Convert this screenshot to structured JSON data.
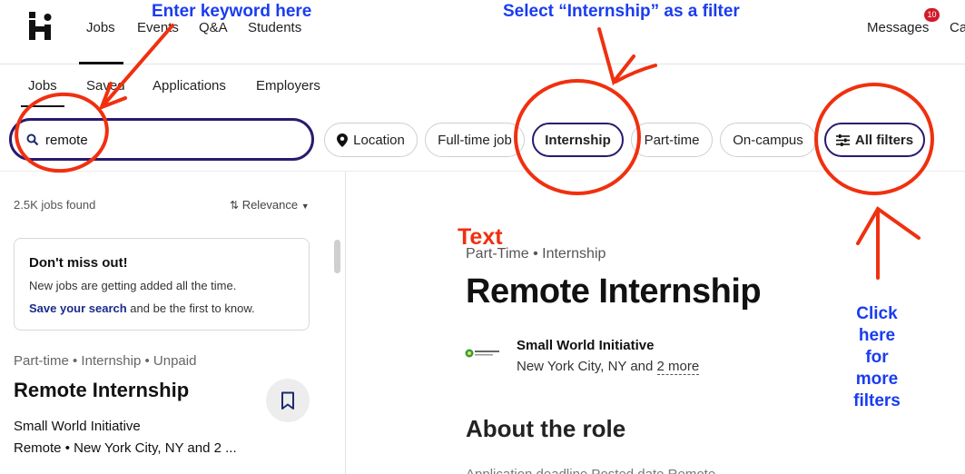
{
  "topnav": {
    "items": [
      {
        "label": "Jobs"
      },
      {
        "label": "Events"
      },
      {
        "label": "Q&A"
      },
      {
        "label": "Students"
      }
    ],
    "messages_label": "Messages",
    "messages_badge": "10",
    "cut_label": "Ca"
  },
  "subnav": {
    "items": [
      {
        "label": "Jobs"
      },
      {
        "label": "Saved"
      },
      {
        "label": "Applications"
      },
      {
        "label": "Employers"
      }
    ]
  },
  "filters": {
    "search_value": "remote",
    "location": "Location",
    "fulltime": "Full-time job",
    "internship": "Internship",
    "parttime": "Part-time",
    "oncampus": "On-campus",
    "allfilters": "All filters"
  },
  "results": {
    "count": "2.5K jobs found",
    "sort": "Relevance"
  },
  "alert": {
    "title": "Don't miss out!",
    "body": "New jobs are getting added all the time.",
    "link": "Save your search",
    "link_suffix": " and be the first to know."
  },
  "job_card": {
    "meta": "Part-time • Internship • Unpaid",
    "title": "Remote Internship",
    "employer": "Small World Initiative",
    "location": "Remote • New York City, NY and 2 ..."
  },
  "detail": {
    "meta": "Part-Time  •  Internship",
    "title": "Remote Internship",
    "employer": "Small World Initiative",
    "location_prefix": "New York City, NY and ",
    "location_more": "2 more",
    "section_title": "About the role",
    "cut_text": "Application deadline          Posted date               Remote"
  },
  "annotations": {
    "keyword": "Enter keyword here",
    "internship": "Select “Internship” as a filter",
    "text": "Text",
    "click_lines": [
      "Click",
      "here",
      "for",
      "more",
      "filters"
    ],
    "color_blue": "#1a3cf0",
    "color_red": "#f0300f"
  },
  "colors": {
    "accent": "#2a1a6e",
    "link": "#1c2a8a",
    "badge": "#d11a2a"
  }
}
